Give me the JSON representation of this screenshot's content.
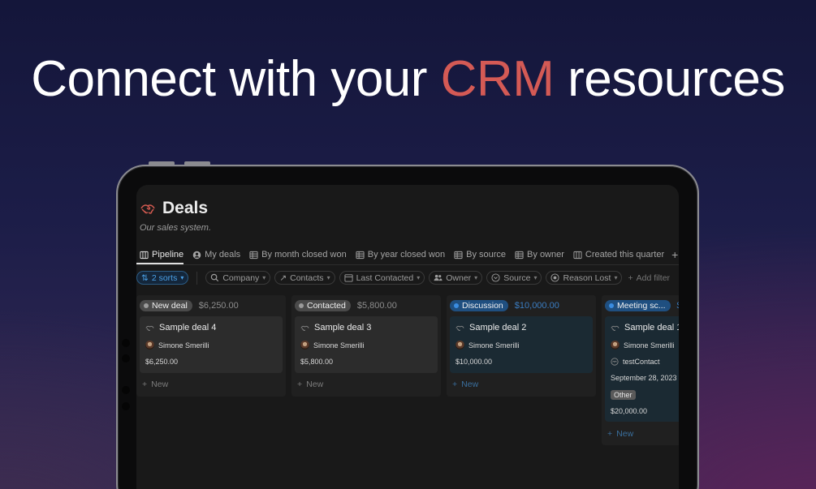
{
  "headline": {
    "before": "Connect with your ",
    "accent": "CRM",
    "after": " resources"
  },
  "colors": {
    "accent_red": "#d45a55",
    "sort_blue": "#4aa0e6",
    "page_bg": "#191919"
  },
  "page": {
    "title": "Deals",
    "title_icon": "handshake-icon",
    "subtitle": "Our sales system."
  },
  "tabs": [
    {
      "label": "Pipeline",
      "icon": "board-icon",
      "active": true
    },
    {
      "label": "My deals",
      "icon": "user-circle-icon"
    },
    {
      "label": "By month closed won",
      "icon": "table-icon"
    },
    {
      "label": "By year closed won",
      "icon": "table-icon"
    },
    {
      "label": "By source",
      "icon": "table-icon"
    },
    {
      "label": "By owner",
      "icon": "table-icon"
    },
    {
      "label": "Created this quarter",
      "icon": "board-icon"
    }
  ],
  "add_view_label": "+",
  "filters": {
    "sorts": "2 sorts",
    "chips": [
      {
        "label": "Company",
        "icon": "search-icon"
      },
      {
        "label": "Contacts",
        "icon": "arrow-up-right-icon"
      },
      {
        "label": "Last Contacted",
        "icon": "calendar-icon"
      },
      {
        "label": "Owner",
        "icon": "people-icon"
      },
      {
        "label": "Source",
        "icon": "circle-chevron-icon"
      },
      {
        "label": "Reason Lost",
        "icon": "circle-chevron-icon"
      }
    ],
    "add_filter": "Add filter"
  },
  "columns": [
    {
      "status": "New deal",
      "status_color": "#8a8a8a",
      "badge_bg": "#4a4a4a",
      "sum": "$6,250.00",
      "card_bg": "#2c2c2c",
      "card": {
        "title": "Sample deal 4",
        "owner": "Simone Smerilli",
        "amount": "$6,250.00"
      },
      "new_label": "New"
    },
    {
      "status": "Contacted",
      "status_color": "#8a8a8a",
      "badge_bg": "#4a4a4a",
      "sum": "$5,800.00",
      "card_bg": "#2c2c2c",
      "card": {
        "title": "Sample deal 3",
        "owner": "Simone Smerilli",
        "amount": "$5,800.00"
      },
      "new_label": "New"
    },
    {
      "status": "Discussion",
      "status_color": "#2f7fd0",
      "badge_bg": "#1f4f80",
      "sum": "$10,000.00",
      "card_bg": "#1b2a33",
      "card": {
        "title": "Sample deal 2",
        "owner": "Simone Smerilli",
        "amount": "$10,000.00"
      },
      "new_label": "New"
    },
    {
      "status": "Meeting sc...",
      "status_color": "#2f7fd0",
      "badge_bg": "#1f4f80",
      "sum": "$",
      "card_bg": "#1b2a33",
      "card": {
        "title": "Sample deal 1",
        "owner": "Simone Smerilli",
        "contact": "testContact",
        "date": "September 28, 2023",
        "tag": "Other",
        "amount": "$20,000.00"
      },
      "new_label": "New"
    }
  ]
}
